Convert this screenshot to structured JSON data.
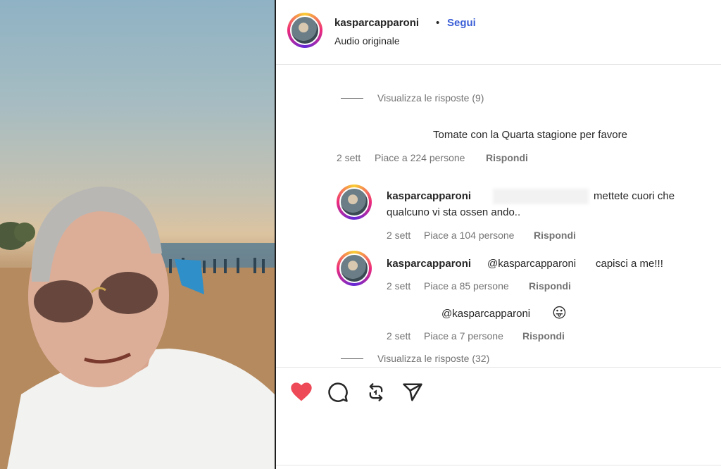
{
  "header": {
    "username": "kasparcapparoni",
    "separator": "•",
    "follow_label": "Segui",
    "audio_label": "Audio originale"
  },
  "comments": {
    "view_replies_top": "Visualizza le risposte (9)",
    "comment1": {
      "text": "Tomate con la Quarta stagione per favore",
      "age": "2 sett",
      "likes": "Piace a 224 persone",
      "reply_label": "Rispondi"
    },
    "reply1": {
      "username": "kasparcapparoni",
      "text_line1": "mettete cuori che",
      "text_line2": "qualcuno vi sta ossen ando..",
      "age": "2 sett",
      "likes": "Piace a 104 persone",
      "reply_label": "Rispondi"
    },
    "reply2": {
      "username": "kasparcapparoni",
      "mention": "@kasparcapparoni",
      "text": "capisci a me!!!",
      "age": "2 sett",
      "likes": "Piace a 85 persone",
      "reply_label": "Rispondi"
    },
    "reply3": {
      "mention": "@kasparcapparoni",
      "emoji": "😛",
      "age": "2 sett",
      "likes": "Piace a 7 persone",
      "reply_label": "Rispondi"
    },
    "view_replies_bottom": "Visualizza le risposte (32)"
  },
  "actions": {
    "like_icon": "heart-filled-icon",
    "comment_icon": "comment-icon",
    "repost_icon": "repost-icon",
    "share_icon": "send-icon",
    "like_color": "#ed4956"
  }
}
